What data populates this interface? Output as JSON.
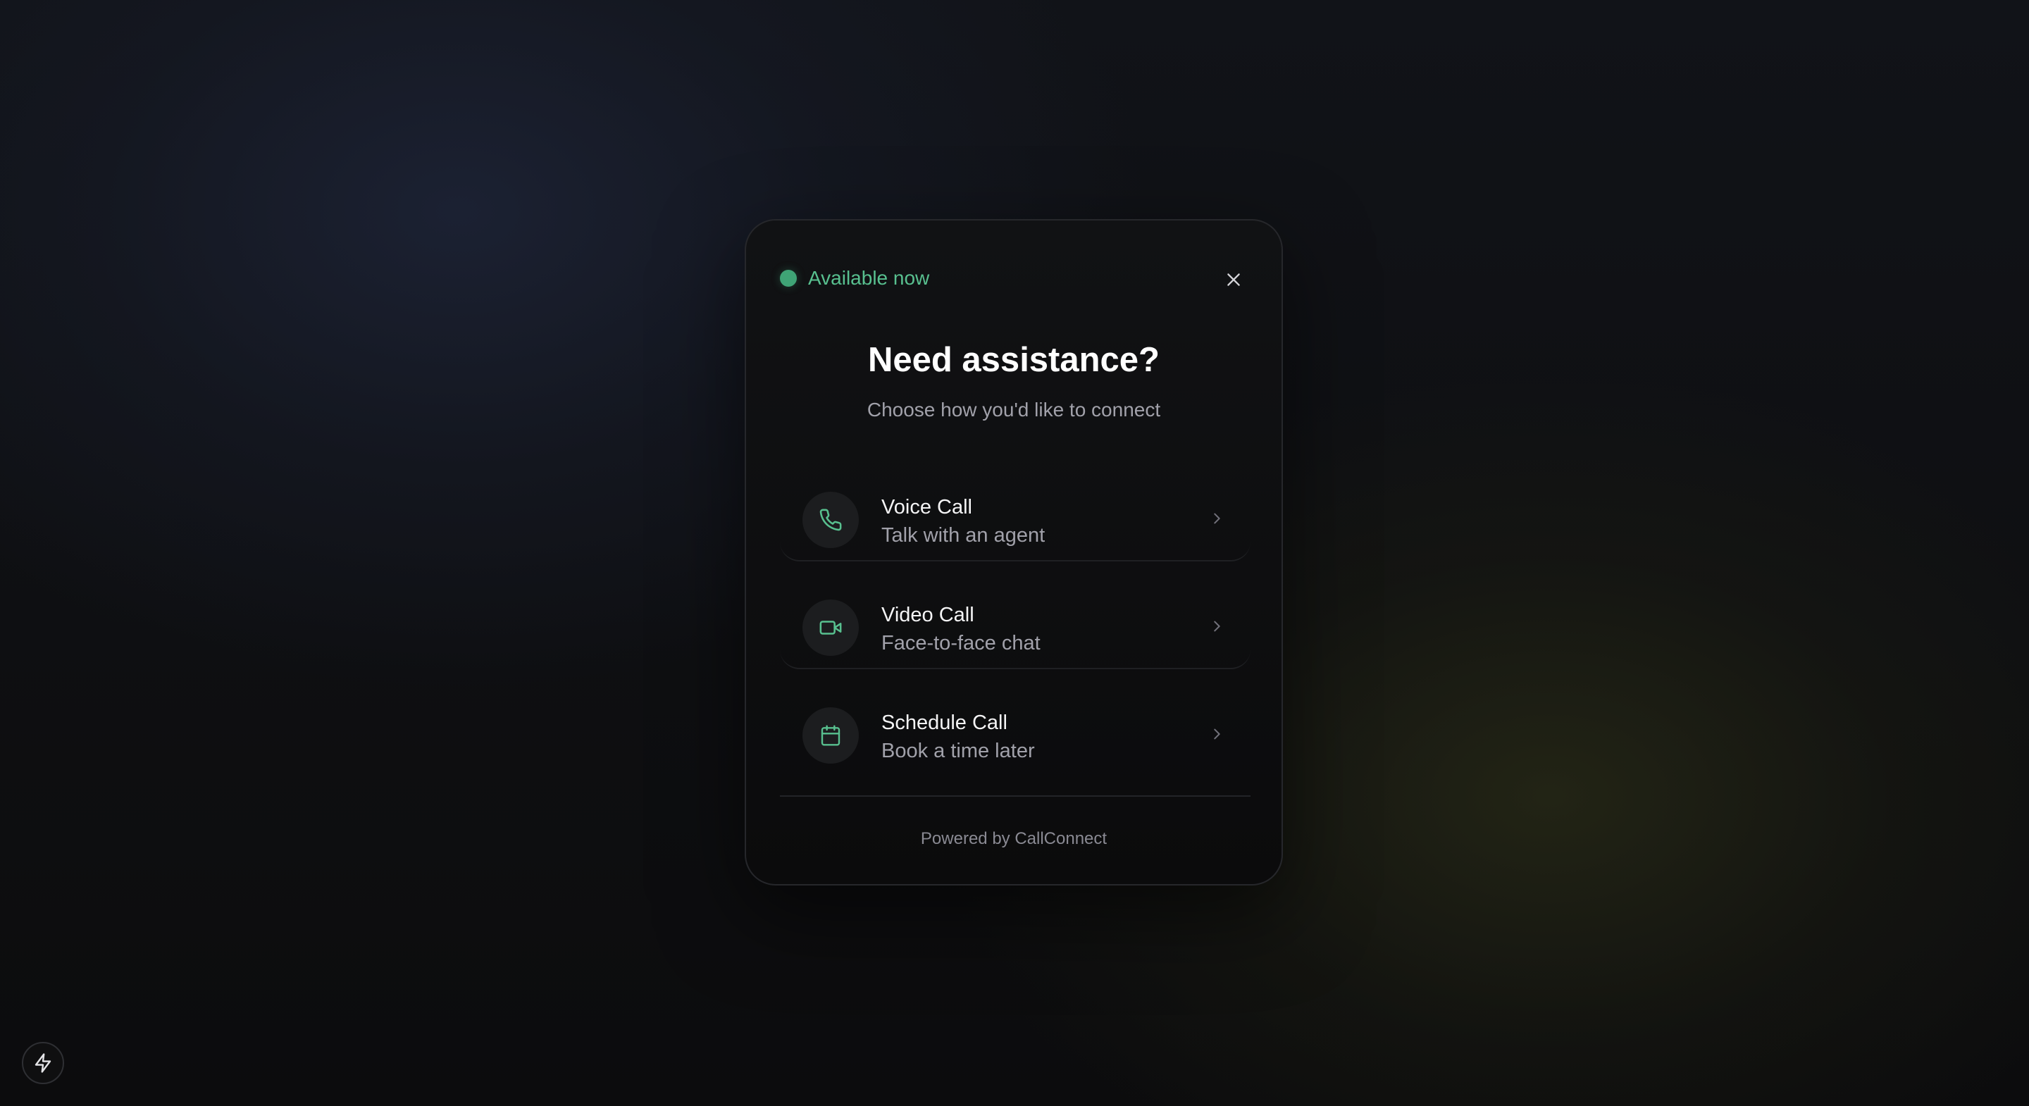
{
  "status": {
    "text": "Available now",
    "color": "#3fa476"
  },
  "close_icon": "close-icon",
  "heading": {
    "title": "Need assistance?",
    "subtitle": "Choose how you'd like to connect"
  },
  "options": [
    {
      "title": "Voice Call",
      "description": "Talk with an agent",
      "icon": "phone-icon"
    },
    {
      "title": "Video Call",
      "description": "Face-to-face chat",
      "icon": "video-camera-icon"
    },
    {
      "title": "Schedule Call",
      "description": "Book a time later",
      "icon": "calendar-icon"
    }
  ],
  "footer": {
    "text": "Powered by CallConnect"
  },
  "corner_button": {
    "icon": "lightning-bolt-icon"
  },
  "colors": {
    "accent": "#58c08f",
    "background": "#0c0c0d",
    "card": "#111214"
  }
}
